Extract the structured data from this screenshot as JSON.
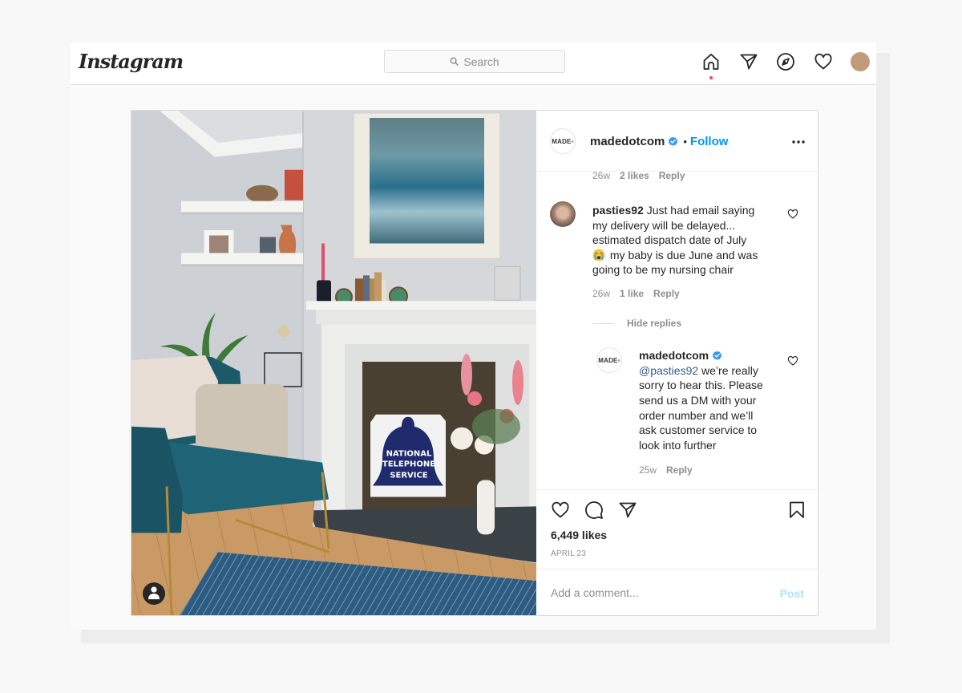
{
  "app": {
    "logo_text": "Instagram"
  },
  "nav": {
    "search_placeholder": "Search",
    "icons": [
      "home-icon",
      "direct-send-icon",
      "explore-compass-icon",
      "activity-heart-icon"
    ],
    "avatar_color": "#c19b78",
    "notification_dot_color": "#ed4956"
  },
  "post": {
    "photo": {
      "sign_text": [
        "NATIONAL",
        "TELEPHONE",
        "SERVICE"
      ],
      "user_tag_icon": "user-tag-icon"
    },
    "header": {
      "avatar_text": "MADE",
      "avatar_mark": "®",
      "username": "madedotcom",
      "verified": true,
      "separator": "•",
      "follow_label": "Follow",
      "more_icon": "more-options-icon"
    },
    "comments": [
      {
        "partial": true,
        "time": "26w",
        "likes": "2 likes",
        "reply": "Reply"
      },
      {
        "username": "pasties92",
        "text": "Just had email saying my delivery will be delayed... estimated dispatch date of July",
        "emoji": "😭",
        "text_after_emoji": "my baby is due June and was going to be my nursing chair",
        "time": "26w",
        "likes": "1 like",
        "reply": "Reply"
      }
    ],
    "hide_replies_label": "Hide replies",
    "reply": {
      "avatar_text": "MADE",
      "avatar_mark": "®",
      "username": "madedotcom",
      "verified": true,
      "mention": "@pasties92",
      "text": "we’re really sorry to hear this. Please send us a DM with your order number and we’ll ask customer service to look into further",
      "time": "25w",
      "reply": "Reply"
    },
    "likes": "6,449 likes",
    "date": "APRIL 23",
    "add_comment_placeholder": "Add a comment...",
    "post_label": "Post"
  },
  "colors": {
    "link_blue": "#0095f6",
    "verified_blue": "#3897f0",
    "post_disabled": "#b2dffc",
    "secondary_text": "#8e8e8e",
    "border": "#dbdbdb"
  }
}
